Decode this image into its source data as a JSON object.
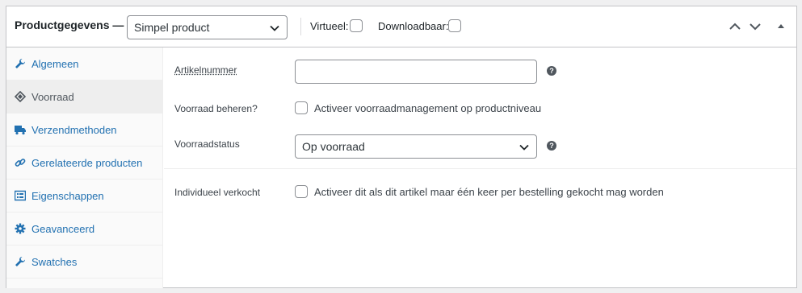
{
  "header": {
    "title": "Productgegevens —",
    "product_type": "Simpel product",
    "virtual_label": "Virtueel:",
    "downloadable_label": "Downloadbaar:"
  },
  "sidebar": {
    "items": [
      {
        "label": "Algemeen",
        "icon": "wrench-icon"
      },
      {
        "label": "Voorraad",
        "icon": "tag-icon"
      },
      {
        "label": "Verzendmethoden",
        "icon": "truck-icon"
      },
      {
        "label": "Gerelateerde producten",
        "icon": "link-icon"
      },
      {
        "label": "Eigenschappen",
        "icon": "list-icon"
      },
      {
        "label": "Geavanceerd",
        "icon": "gear-icon"
      },
      {
        "label": "Swatches",
        "icon": "wrench-icon"
      }
    ],
    "active_index": 1
  },
  "inventory": {
    "sku_label": "Artikelnummer",
    "sku_value": "",
    "manage_label": "Voorraad beheren?",
    "manage_desc": "Activeer voorraadmanagement op productniveau",
    "status_label": "Voorraadstatus",
    "status_value": "Op voorraad",
    "sold_individually_label": "Individueel verkocht",
    "sold_individually_desc": "Activeer dit als dit artikel maar één keer per bestelling gekocht mag worden"
  },
  "colors": {
    "link": "#2271b1",
    "border": "#c3c4c7",
    "active_tab_bg": "#eeeeee"
  }
}
